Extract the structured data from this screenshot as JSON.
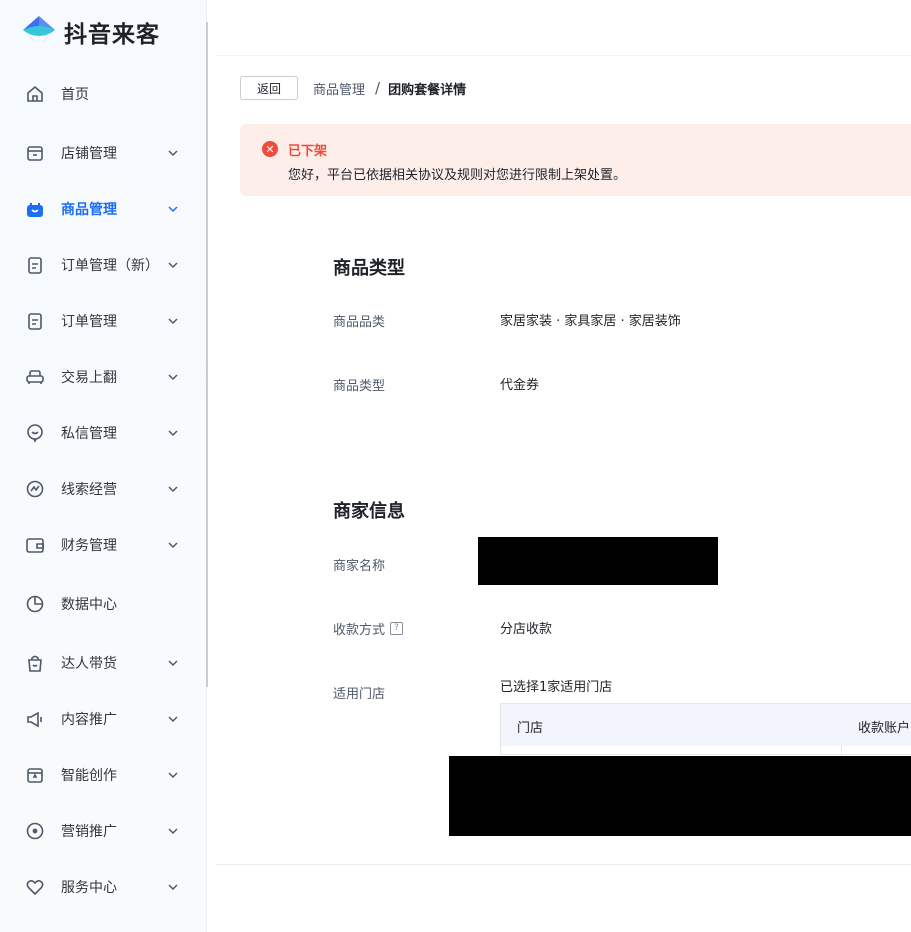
{
  "app": {
    "brand": "抖音来客",
    "brand_colors": {
      "blue": "#1d6ff2",
      "cyan": "#37c6d9",
      "dark": "#1f2329"
    }
  },
  "sidebar": {
    "items": [
      {
        "label": "首页",
        "icon": "home-icon",
        "has_chevron": false,
        "active": false
      },
      {
        "label": "店铺管理",
        "icon": "store-icon",
        "has_chevron": true,
        "active": false
      },
      {
        "label": "商品管理",
        "icon": "shopping-bag-icon",
        "has_chevron": true,
        "active": true
      },
      {
        "label": "订单管理（新）",
        "icon": "clipboard-icon",
        "has_chevron": true,
        "active": false
      },
      {
        "label": "订单管理",
        "icon": "clipboard-icon",
        "has_chevron": true,
        "active": false
      },
      {
        "label": "交易上翻",
        "icon": "sofa-icon",
        "has_chevron": true,
        "active": false
      },
      {
        "label": "私信管理",
        "icon": "chat-icon",
        "has_chevron": true,
        "active": false
      },
      {
        "label": "线索经营",
        "icon": "leads-icon",
        "has_chevron": true,
        "active": false
      },
      {
        "label": "财务管理",
        "icon": "wallet-icon",
        "has_chevron": true,
        "active": false
      },
      {
        "label": "数据中心",
        "icon": "pie-chart-icon",
        "has_chevron": false,
        "active": false
      },
      {
        "label": "达人带货",
        "icon": "bag-smile-icon",
        "has_chevron": true,
        "active": false
      },
      {
        "label": "内容推广",
        "icon": "megaphone-icon",
        "has_chevron": true,
        "active": false
      },
      {
        "label": "智能创作",
        "icon": "calendar-star-icon",
        "has_chevron": true,
        "active": false
      },
      {
        "label": "营销推广",
        "icon": "location-pin-icon",
        "has_chevron": true,
        "active": false
      },
      {
        "label": "服务中心",
        "icon": "heart-icon",
        "has_chevron": true,
        "active": false
      }
    ]
  },
  "breadcrumb": {
    "back_label": "返回",
    "parent": "商品管理",
    "separator": "/",
    "current": "团购套餐详情"
  },
  "alert": {
    "icon": "error-circle-icon",
    "title": "已下架",
    "message": "您好，平台已依据相关协议及规则对您进行限制上架处置。",
    "color": "#f04b3a",
    "background": "#fdeeea"
  },
  "product_type": {
    "title": "商品类型",
    "category_label": "商品品类",
    "category_value": "家居家装 · 家具家居 · 家居装饰",
    "type_label": "商品类型",
    "type_value": "代金券"
  },
  "merchant": {
    "title": "商家信息",
    "name_label": "商家名称",
    "payment_label": "收款方式",
    "payment_value": "分店收款",
    "stores_label": "适用门店",
    "stores_summary": "已选择1家适用门店",
    "table_headers": [
      "门店",
      "收款账户"
    ]
  }
}
